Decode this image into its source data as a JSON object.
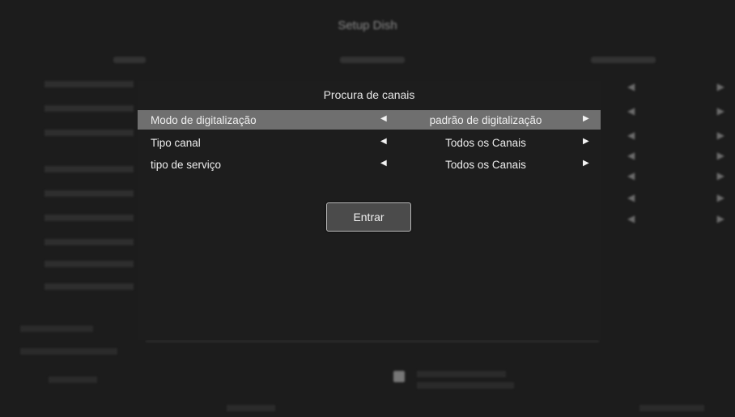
{
  "screen": {
    "title": "Setup Dish"
  },
  "dialog": {
    "title": "Procura de canais",
    "options": [
      {
        "label": "Modo de digitalização",
        "value": "padrão de digitalização",
        "selected": true
      },
      {
        "label": "Tipo canal",
        "value": "Todos os Canais",
        "selected": false
      },
      {
        "label": "tipo de serviço",
        "value": "Todos os Canais",
        "selected": false
      }
    ],
    "arrow_left": "◀",
    "arrow_right": "▶",
    "enter_label": "Entrar"
  },
  "colors": {
    "selected_row": "#6f6f6f",
    "background": "#1c1c1c",
    "button_bg": "#4b4b4b"
  }
}
